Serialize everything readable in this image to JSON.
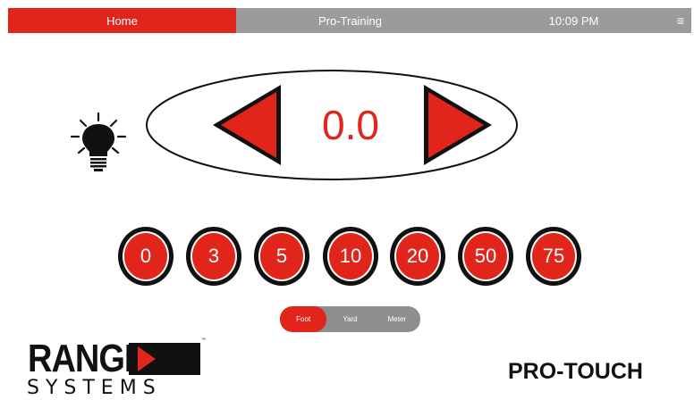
{
  "topbar": {
    "home_label": "Home",
    "title": "Pro-Training",
    "time": "10:09 PM",
    "menu_glyph": "≡"
  },
  "controller": {
    "value": "0.0",
    "left_arrow_icon": "left-triangle-icon",
    "right_arrow_icon": "right-triangle-icon"
  },
  "light_icon": "lightbulb-icon",
  "presets": [
    "0",
    "3",
    "5",
    "10",
    "20",
    "50",
    "75"
  ],
  "units": {
    "options": [
      "Foot",
      "Yard",
      "Meter"
    ],
    "selected": "Foot"
  },
  "branding": {
    "range_word": "RANGE",
    "systems_word": "SYSTEMS",
    "tm": "™",
    "product": "PRO-TOUCH"
  },
  "colors": {
    "accent": "#e1251b",
    "bar_gray": "#9b9b9b",
    "segment_gray": "#8e8e8e"
  }
}
